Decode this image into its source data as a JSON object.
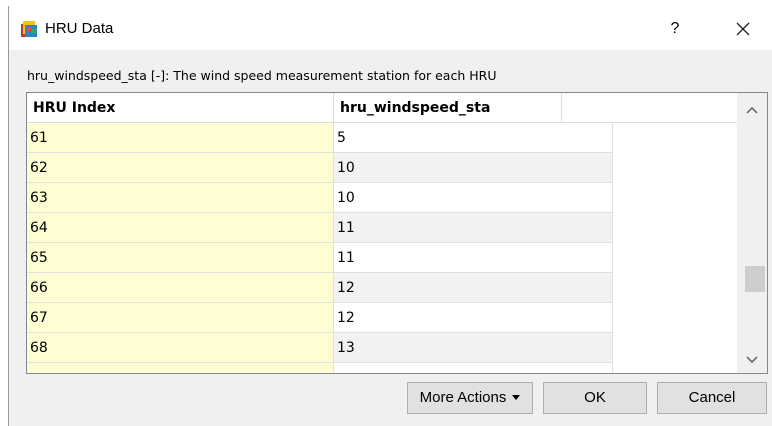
{
  "window": {
    "title": "HRU Data",
    "app_icon": "hru-app-icon",
    "help_label": "?",
    "close_icon": "close-icon"
  },
  "description": "hru_windspeed_sta [-]: The wind speed measurement station for each HRU",
  "table": {
    "columns": [
      "HRU Index",
      "hru_windspeed_sta",
      ""
    ],
    "rows": [
      {
        "index": "61",
        "value": "5"
      },
      {
        "index": "62",
        "value": "10"
      },
      {
        "index": "63",
        "value": "10"
      },
      {
        "index": "64",
        "value": "11"
      },
      {
        "index": "65",
        "value": "11"
      },
      {
        "index": "66",
        "value": "12"
      },
      {
        "index": "67",
        "value": "12"
      },
      {
        "index": "68",
        "value": "13"
      }
    ],
    "index_column_color": "#fffdd4",
    "alt_row_color": "#f2f2f2"
  },
  "buttons": {
    "more_actions": "More Actions",
    "ok": "OK",
    "cancel": "Cancel"
  }
}
